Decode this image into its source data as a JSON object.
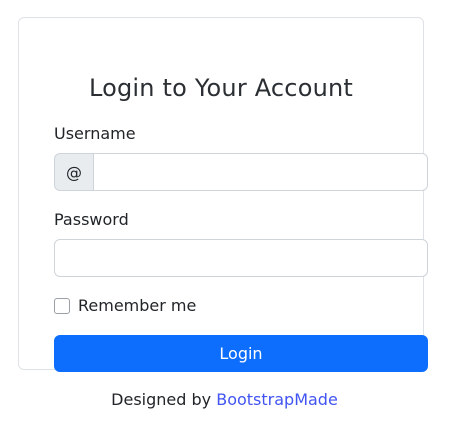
{
  "login": {
    "title": "Login to Your Account",
    "username_label": "Username",
    "username_prefix": "@",
    "username_value": "",
    "password_label": "Password",
    "password_value": "",
    "remember_label": "Remember me",
    "remember_checked": false,
    "submit_label": "Login"
  },
  "footer": {
    "designed_by": "Designed by",
    "link_text": "BootstrapMade",
    "link_color": "#4154f1"
  },
  "colors": {
    "primary": "#0d6efd",
    "border": "#dee2e6",
    "addon_bg": "#e9ecef"
  }
}
